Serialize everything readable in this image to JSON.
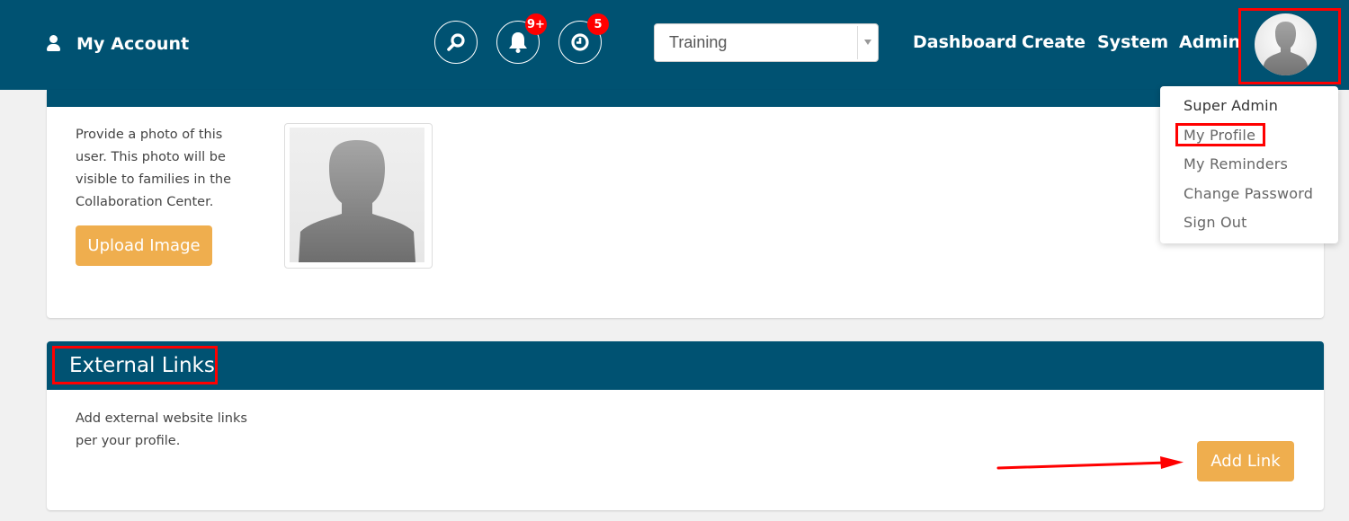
{
  "header": {
    "account_label": "My Account",
    "icons": {
      "search": "search-icon",
      "notifications": "bell-icon",
      "reminders": "clock-icon"
    },
    "notification_badge": "9+",
    "reminder_badge": "5",
    "environment_select": {
      "selected": "Training"
    },
    "nav": [
      "Dashboard",
      "Create",
      "System",
      "Admin"
    ]
  },
  "user_menu": {
    "user_name": "Super Admin",
    "items": [
      "My Profile",
      "My Reminders",
      "Change Password",
      "Sign Out"
    ]
  },
  "photo_section": {
    "description_lines": [
      "Provide a photo of this",
      "user. This photo will be",
      "visible to families in the",
      "Collaboration Center."
    ],
    "upload_button": "Upload Image"
  },
  "external_links": {
    "title": "External Links",
    "description_lines": [
      "Add external website links",
      "per your profile."
    ],
    "add_button": "Add Link"
  },
  "colors": {
    "primary": "#005272",
    "accent_button": "#efae4e",
    "badge": "#ff0000",
    "annotation": "#ff0000"
  }
}
